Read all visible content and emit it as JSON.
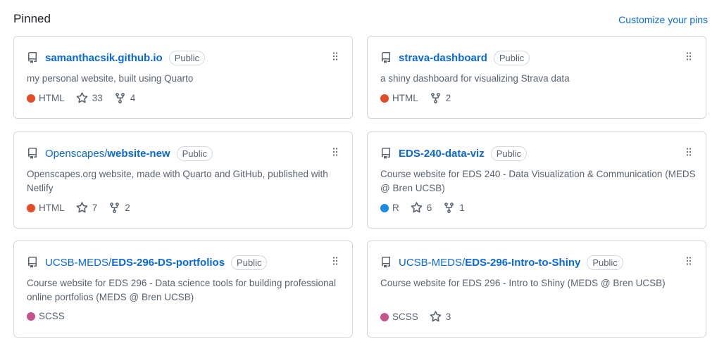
{
  "header": {
    "title": "Pinned",
    "customize_label": "Customize your pins"
  },
  "pins": [
    {
      "owner": "",
      "name": "samanthacsik.github.io",
      "visibility": "Public",
      "description": "my personal website, built using Quarto",
      "language": "HTML",
      "language_color": "#e34c26",
      "stars": "33",
      "forks": "4"
    },
    {
      "owner": "",
      "name": "strava-dashboard",
      "visibility": "Public",
      "description": "a shiny dashboard for visualizing Strava data",
      "language": "HTML",
      "language_color": "#e34c26",
      "stars": "",
      "forks": "2"
    },
    {
      "owner": "Openscapes/",
      "name": "website-new",
      "visibility": "Public",
      "description": "Openscapes.org website, made with Quarto and GitHub, published with Netlify",
      "language": "HTML",
      "language_color": "#e34c26",
      "stars": "7",
      "forks": "2"
    },
    {
      "owner": "",
      "name": "EDS-240-data-viz",
      "visibility": "Public",
      "description": "Course website for EDS 240 - Data Visualization & Communication (MEDS @ Bren UCSB)",
      "language": "R",
      "language_color": "#198ce7",
      "stars": "6",
      "forks": "1"
    },
    {
      "owner": "UCSB-MEDS/",
      "name": "EDS-296-DS-portfolios",
      "visibility": "Public",
      "description": "Course website for EDS 296 - Data science tools for building professional online portfolios (MEDS @ Bren UCSB)",
      "language": "SCSS",
      "language_color": "#c6538c",
      "stars": "",
      "forks": ""
    },
    {
      "owner": "UCSB-MEDS/",
      "name": "EDS-296-Intro-to-Shiny",
      "visibility": "Public",
      "description": "Course website for EDS 296 - Intro to Shiny (MEDS @ Bren UCSB)",
      "language": "SCSS",
      "language_color": "#c6538c",
      "stars": "3",
      "forks": ""
    }
  ]
}
